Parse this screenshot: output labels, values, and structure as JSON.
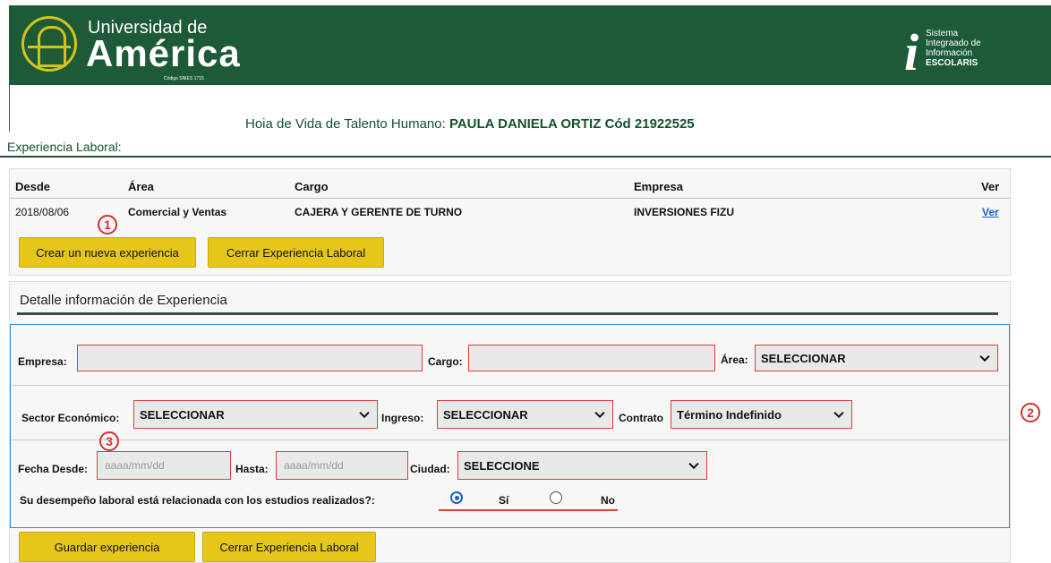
{
  "header": {
    "logo_line1": "Universidad de",
    "logo_line2": "América",
    "logo_code": "Código SNIES 1715",
    "system_lines": [
      "Sistema",
      "Integraado de",
      "Información",
      "ESCOLARIS"
    ],
    "brand_color": "#1d5a38",
    "accent_color": "#d4c319"
  },
  "page": {
    "title_prefix": "Hoia de Vida de Talento Humano:",
    "person_name": "PAULA DANIELA ORTIZ",
    "code_label": "Cód",
    "code_value": "21922525",
    "section_title": "Experiencia Laboral:"
  },
  "table": {
    "headers": [
      "Desde",
      "Área",
      "Cargo",
      "Empresa",
      "Ver"
    ],
    "rows": [
      {
        "desde": "2018/08/06",
        "area": "Comercial y Ventas",
        "cargo": "CAJERA Y GERENTE DE TURNO",
        "empresa": "INVERSIONES FIZU",
        "ver": "Ver"
      }
    ],
    "btn_create": "Crear un nueva experiencia",
    "btn_close": "Cerrar Experiencia Laboral"
  },
  "markers": [
    "1",
    "2",
    "3"
  ],
  "detail": {
    "title": "Detalle información de Experiencia",
    "empresa_label": "Empresa:",
    "empresa_value": "",
    "cargo_label": "Cargo:",
    "cargo_value": "",
    "area_label": "Área:",
    "area_value": "SELECCIONAR",
    "sector_label": "Sector Económico:",
    "sector_value": "SELECCIONAR",
    "ingreso_label": "Ingreso:",
    "ingreso_value": "SELECCIONAR",
    "contrato_label": "Contrato",
    "contrato_value": "Término Indefinido",
    "fecha_desde_label": "Fecha Desde:",
    "fecha_desde_placeholder": "aaaa/mm/dd",
    "hasta_label": "Hasta:",
    "hasta_placeholder": "aaaa/mm/dd",
    "ciudad_label": "Ciudad:",
    "ciudad_value": "SELECCIONE",
    "question": "Su desempeño laboral está relacionada con los estudios realizados?:",
    "opt_yes": "Sí",
    "opt_no": "No",
    "selected": "Sí",
    "btn_save": "Guardar experiencia",
    "btn_close": "Cerrar Experiencia Laboral"
  }
}
